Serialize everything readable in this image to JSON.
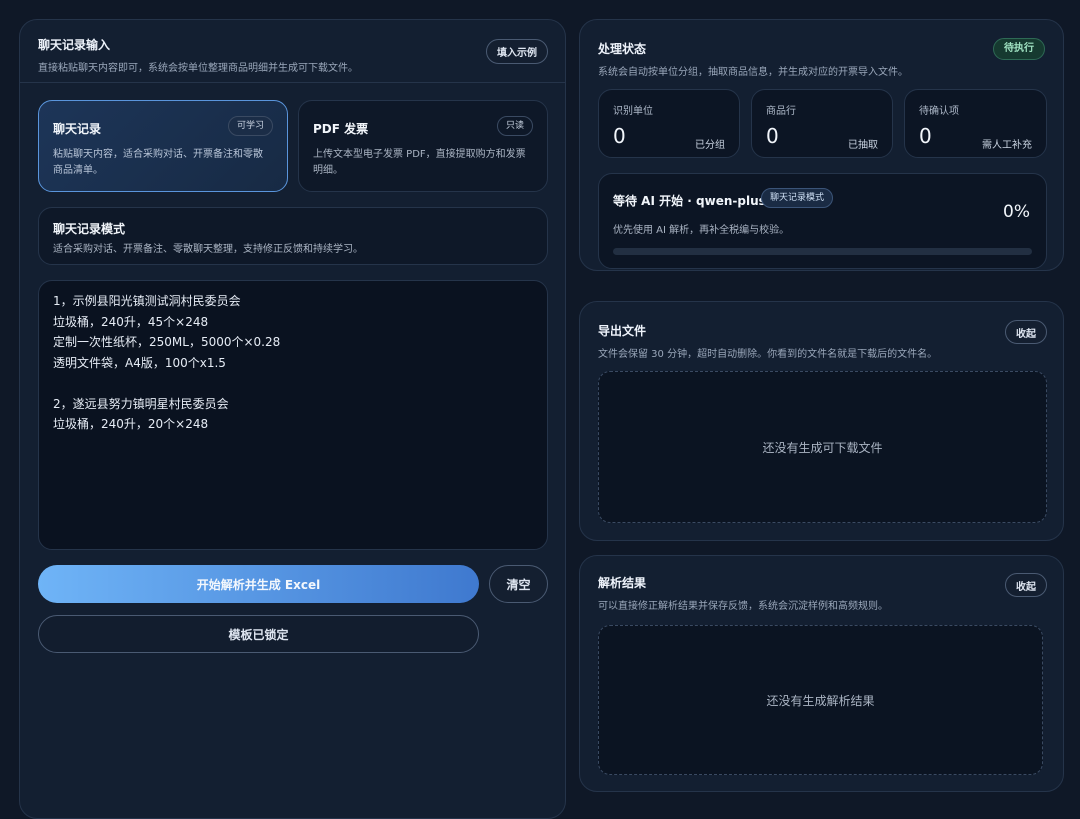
{
  "input_panel": {
    "title": "聊天记录输入",
    "subtitle": "直接粘贴聊天内容即可，系统会按单位整理商品明细并生成可下载文件。",
    "fill_example_label": "填入示例"
  },
  "modes": [
    {
      "title": "聊天记录",
      "badge": "可学习",
      "desc_line1": "粘贴聊天内容，适合采购对话、开票备注和零散",
      "desc_line2": "商品清单。"
    },
    {
      "title": "PDF 发票",
      "badge": "只读",
      "desc_line1": "上传文本型电子发票 PDF，直接提取购方和发票",
      "desc_line2": "明细。"
    }
  ],
  "mode_info": {
    "title": "聊天记录模式",
    "desc": "适合采购对话、开票备注、零散聊天整理，支持修正反馈和持续学习。"
  },
  "chat_text": {
    "lines": [
      "1，示例县阳光镇测试洞村民委员会",
      "垃圾桶，240升，45个×248",
      "定制一次性纸杯，250ML，5000个×0.28",
      "透明文件袋，A4版，100个x1.5",
      "",
      "2，遂远县努力镇明星村民委员会",
      "垃圾桶，240升，20个×248"
    ]
  },
  "actions": {
    "parse_label": "开始解析并生成 Excel",
    "clear_label": "清空",
    "template_label": "模板已锁定"
  },
  "status_panel": {
    "title": "处理状态",
    "subtitle": "系统会自动按单位分组，抽取商品信息，并生成对应的开票导入文件。",
    "badge": "待执行",
    "stats": [
      {
        "label": "识别单位",
        "value": "0",
        "note": "已分组"
      },
      {
        "label": "商品行",
        "value": "0",
        "note": "已抽取"
      },
      {
        "label": "待确认项",
        "value": "0",
        "note": "需人工补充"
      }
    ],
    "progress": {
      "title": "等待 AI 开始 · qwen-plus",
      "mode_badge": "聊天记录模式",
      "desc": "优先使用 AI 解析，再补全税编与校验。",
      "percent_text": "0%",
      "percent": 0
    }
  },
  "export_panel": {
    "title": "导出文件",
    "subtitle": "文件会保留 30 分钟，超时自动删除。你看到的文件名就是下载后的文件名。",
    "collapse_label": "收起",
    "empty_text": "还没有生成可下载文件"
  },
  "result_panel": {
    "title": "解析结果",
    "subtitle": "可以直接修正解析结果并保存反馈，系统会沉淀样例和高频规则。",
    "collapse_label": "收起",
    "empty_text": "还没有生成解析结果"
  },
  "colors": {
    "accent_gradient_start": "#6fb4f7",
    "accent_gradient_end": "#3f79cf",
    "status_badge_text": "#9fe2c1",
    "status_badge_bg": "#163a30"
  }
}
